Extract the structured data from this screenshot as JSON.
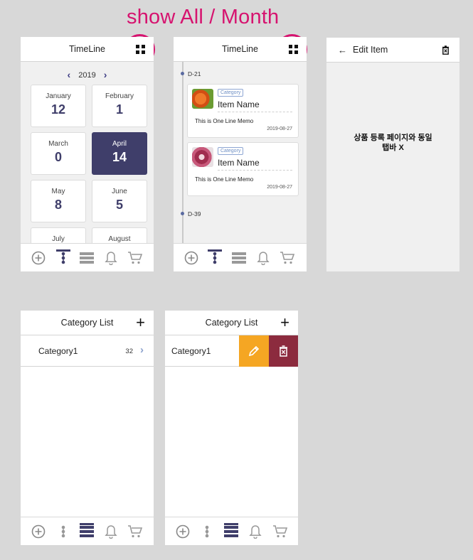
{
  "annotation": "show All / Month",
  "timeline_month": {
    "title": "TimeLine",
    "year": "2019",
    "months": [
      {
        "name": "January",
        "count": "12",
        "active": false
      },
      {
        "name": "February",
        "count": "1",
        "active": false
      },
      {
        "name": "March",
        "count": "0",
        "active": false
      },
      {
        "name": "April",
        "count": "14",
        "active": true
      },
      {
        "name": "May",
        "count": "8",
        "active": false
      },
      {
        "name": "June",
        "count": "5",
        "active": false
      },
      {
        "name": "July",
        "count": "",
        "active": false
      },
      {
        "name": "August",
        "count": "",
        "active": false
      }
    ]
  },
  "timeline_list": {
    "title": "TimeLine",
    "groups": [
      "D-21",
      "D-39"
    ],
    "items": [
      {
        "category": "Category",
        "name": "Item Name",
        "memo": "This is One Line Memo",
        "date": "2019-08-27",
        "thumb": "carrot"
      },
      {
        "category": "Category",
        "name": "Item Name",
        "memo": "This is One Line Memo",
        "date": "2019-08-27",
        "thumb": "onion"
      }
    ]
  },
  "edit_item": {
    "title": "Edit Item",
    "note_line1": "상품 등록 페이지와 동일",
    "note_line2": "탭바 X"
  },
  "category_list": {
    "title": "Category List",
    "rows": [
      {
        "name": "Category1",
        "count": "32"
      }
    ]
  },
  "category_swipe": {
    "title": "Category List",
    "rows": [
      {
        "name": "Category1"
      }
    ]
  },
  "tabbar_icons": [
    "add-circle-icon",
    "timeline-icon",
    "list-icon",
    "bell-icon",
    "cart-icon"
  ],
  "colors": {
    "accent": "#3f3e6a",
    "annotation": "#d6136f",
    "edit": "#f5a623",
    "delete": "#8c2b3e"
  }
}
